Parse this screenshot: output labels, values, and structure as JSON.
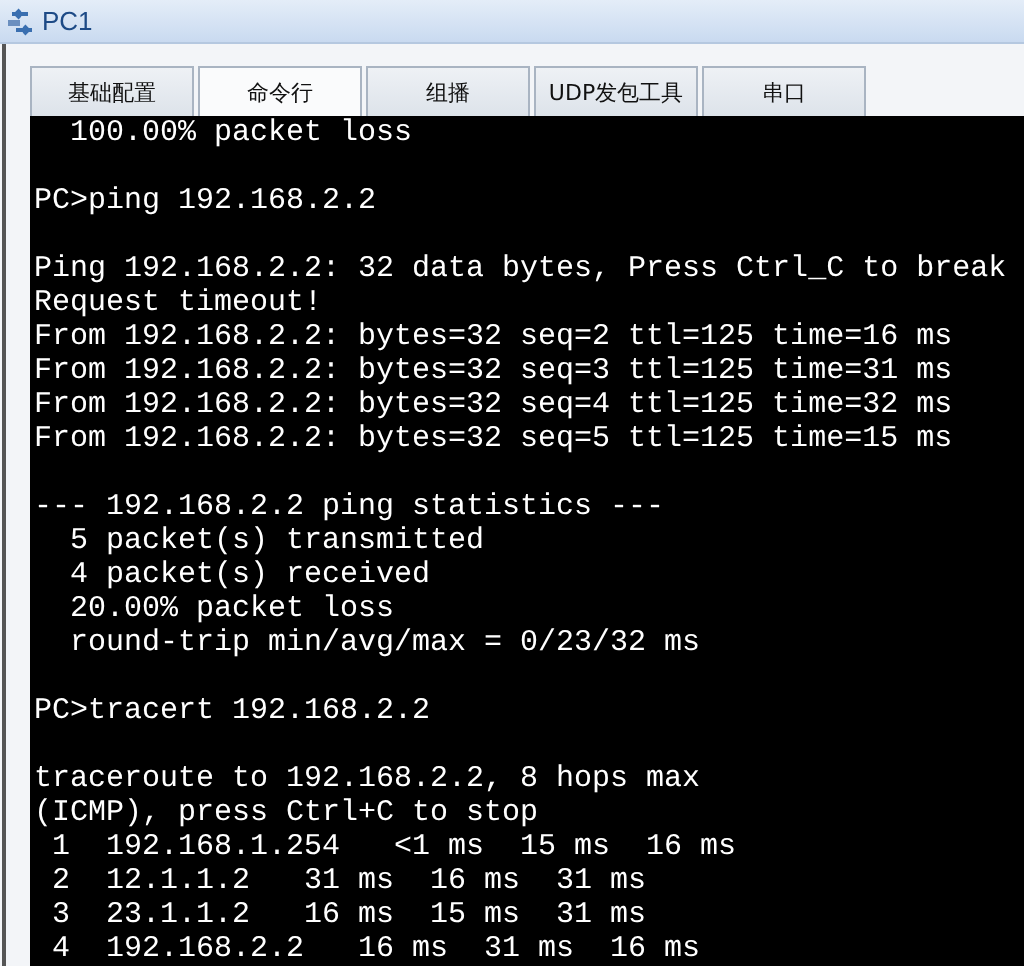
{
  "window": {
    "title": "PC1"
  },
  "tabs": [
    {
      "label": "基础配置",
      "selected": false
    },
    {
      "label": "命令行",
      "selected": true
    },
    {
      "label": "组播",
      "selected": false
    },
    {
      "label": "UDP发包工具",
      "selected": false
    },
    {
      "label": "串口",
      "selected": false
    }
  ],
  "terminal": {
    "blocks": [
      [
        "  100.00% packet loss"
      ],
      [
        "PC>ping 192.168.2.2"
      ],
      [
        "Ping 192.168.2.2: 32 data bytes, Press Ctrl_C to break",
        "Request timeout!",
        "From 192.168.2.2: bytes=32 seq=2 ttl=125 time=16 ms",
        "From 192.168.2.2: bytes=32 seq=3 ttl=125 time=31 ms",
        "From 192.168.2.2: bytes=32 seq=4 ttl=125 time=32 ms",
        "From 192.168.2.2: bytes=32 seq=5 ttl=125 time=15 ms"
      ],
      [
        "--- 192.168.2.2 ping statistics ---",
        "  5 packet(s) transmitted",
        "  4 packet(s) received",
        "  20.00% packet loss",
        "  round-trip min/avg/max = 0/23/32 ms"
      ],
      [
        "PC>tracert 192.168.2.2"
      ],
      [
        "traceroute to 192.168.2.2, 8 hops max",
        "(ICMP), press Ctrl+C to stop",
        " 1  192.168.1.254   <1 ms  15 ms  16 ms",
        " 2  12.1.1.2   31 ms  16 ms  31 ms",
        " 3  23.1.1.2   16 ms  15 ms  31 ms",
        " 4  192.168.2.2   16 ms  31 ms  16 ms"
      ]
    ]
  }
}
